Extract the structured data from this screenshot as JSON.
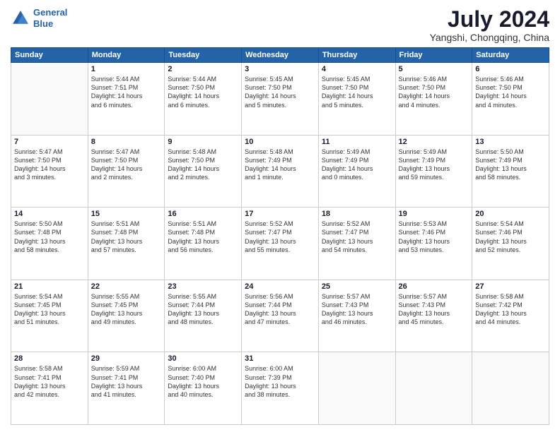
{
  "logo": {
    "line1": "General",
    "line2": "Blue"
  },
  "title": "July 2024",
  "subtitle": "Yangshi, Chongqing, China",
  "weekdays": [
    "Sunday",
    "Monday",
    "Tuesday",
    "Wednesday",
    "Thursday",
    "Friday",
    "Saturday"
  ],
  "weeks": [
    [
      {
        "day": "",
        "content": ""
      },
      {
        "day": "1",
        "content": "Sunrise: 5:44 AM\nSunset: 7:51 PM\nDaylight: 14 hours\nand 6 minutes."
      },
      {
        "day": "2",
        "content": "Sunrise: 5:44 AM\nSunset: 7:50 PM\nDaylight: 14 hours\nand 6 minutes."
      },
      {
        "day": "3",
        "content": "Sunrise: 5:45 AM\nSunset: 7:50 PM\nDaylight: 14 hours\nand 5 minutes."
      },
      {
        "day": "4",
        "content": "Sunrise: 5:45 AM\nSunset: 7:50 PM\nDaylight: 14 hours\nand 5 minutes."
      },
      {
        "day": "5",
        "content": "Sunrise: 5:46 AM\nSunset: 7:50 PM\nDaylight: 14 hours\nand 4 minutes."
      },
      {
        "day": "6",
        "content": "Sunrise: 5:46 AM\nSunset: 7:50 PM\nDaylight: 14 hours\nand 4 minutes."
      }
    ],
    [
      {
        "day": "7",
        "content": "Sunrise: 5:47 AM\nSunset: 7:50 PM\nDaylight: 14 hours\nand 3 minutes."
      },
      {
        "day": "8",
        "content": "Sunrise: 5:47 AM\nSunset: 7:50 PM\nDaylight: 14 hours\nand 2 minutes."
      },
      {
        "day": "9",
        "content": "Sunrise: 5:48 AM\nSunset: 7:50 PM\nDaylight: 14 hours\nand 2 minutes."
      },
      {
        "day": "10",
        "content": "Sunrise: 5:48 AM\nSunset: 7:49 PM\nDaylight: 14 hours\nand 1 minute."
      },
      {
        "day": "11",
        "content": "Sunrise: 5:49 AM\nSunset: 7:49 PM\nDaylight: 14 hours\nand 0 minutes."
      },
      {
        "day": "12",
        "content": "Sunrise: 5:49 AM\nSunset: 7:49 PM\nDaylight: 13 hours\nand 59 minutes."
      },
      {
        "day": "13",
        "content": "Sunrise: 5:50 AM\nSunset: 7:49 PM\nDaylight: 13 hours\nand 58 minutes."
      }
    ],
    [
      {
        "day": "14",
        "content": "Sunrise: 5:50 AM\nSunset: 7:48 PM\nDaylight: 13 hours\nand 58 minutes."
      },
      {
        "day": "15",
        "content": "Sunrise: 5:51 AM\nSunset: 7:48 PM\nDaylight: 13 hours\nand 57 minutes."
      },
      {
        "day": "16",
        "content": "Sunrise: 5:51 AM\nSunset: 7:48 PM\nDaylight: 13 hours\nand 56 minutes."
      },
      {
        "day": "17",
        "content": "Sunrise: 5:52 AM\nSunset: 7:47 PM\nDaylight: 13 hours\nand 55 minutes."
      },
      {
        "day": "18",
        "content": "Sunrise: 5:52 AM\nSunset: 7:47 PM\nDaylight: 13 hours\nand 54 minutes."
      },
      {
        "day": "19",
        "content": "Sunrise: 5:53 AM\nSunset: 7:46 PM\nDaylight: 13 hours\nand 53 minutes."
      },
      {
        "day": "20",
        "content": "Sunrise: 5:54 AM\nSunset: 7:46 PM\nDaylight: 13 hours\nand 52 minutes."
      }
    ],
    [
      {
        "day": "21",
        "content": "Sunrise: 5:54 AM\nSunset: 7:45 PM\nDaylight: 13 hours\nand 51 minutes."
      },
      {
        "day": "22",
        "content": "Sunrise: 5:55 AM\nSunset: 7:45 PM\nDaylight: 13 hours\nand 49 minutes."
      },
      {
        "day": "23",
        "content": "Sunrise: 5:55 AM\nSunset: 7:44 PM\nDaylight: 13 hours\nand 48 minutes."
      },
      {
        "day": "24",
        "content": "Sunrise: 5:56 AM\nSunset: 7:44 PM\nDaylight: 13 hours\nand 47 minutes."
      },
      {
        "day": "25",
        "content": "Sunrise: 5:57 AM\nSunset: 7:43 PM\nDaylight: 13 hours\nand 46 minutes."
      },
      {
        "day": "26",
        "content": "Sunrise: 5:57 AM\nSunset: 7:43 PM\nDaylight: 13 hours\nand 45 minutes."
      },
      {
        "day": "27",
        "content": "Sunrise: 5:58 AM\nSunset: 7:42 PM\nDaylight: 13 hours\nand 44 minutes."
      }
    ],
    [
      {
        "day": "28",
        "content": "Sunrise: 5:58 AM\nSunset: 7:41 PM\nDaylight: 13 hours\nand 42 minutes."
      },
      {
        "day": "29",
        "content": "Sunrise: 5:59 AM\nSunset: 7:41 PM\nDaylight: 13 hours\nand 41 minutes."
      },
      {
        "day": "30",
        "content": "Sunrise: 6:00 AM\nSunset: 7:40 PM\nDaylight: 13 hours\nand 40 minutes."
      },
      {
        "day": "31",
        "content": "Sunrise: 6:00 AM\nSunset: 7:39 PM\nDaylight: 13 hours\nand 38 minutes."
      },
      {
        "day": "",
        "content": ""
      },
      {
        "day": "",
        "content": ""
      },
      {
        "day": "",
        "content": ""
      }
    ]
  ]
}
